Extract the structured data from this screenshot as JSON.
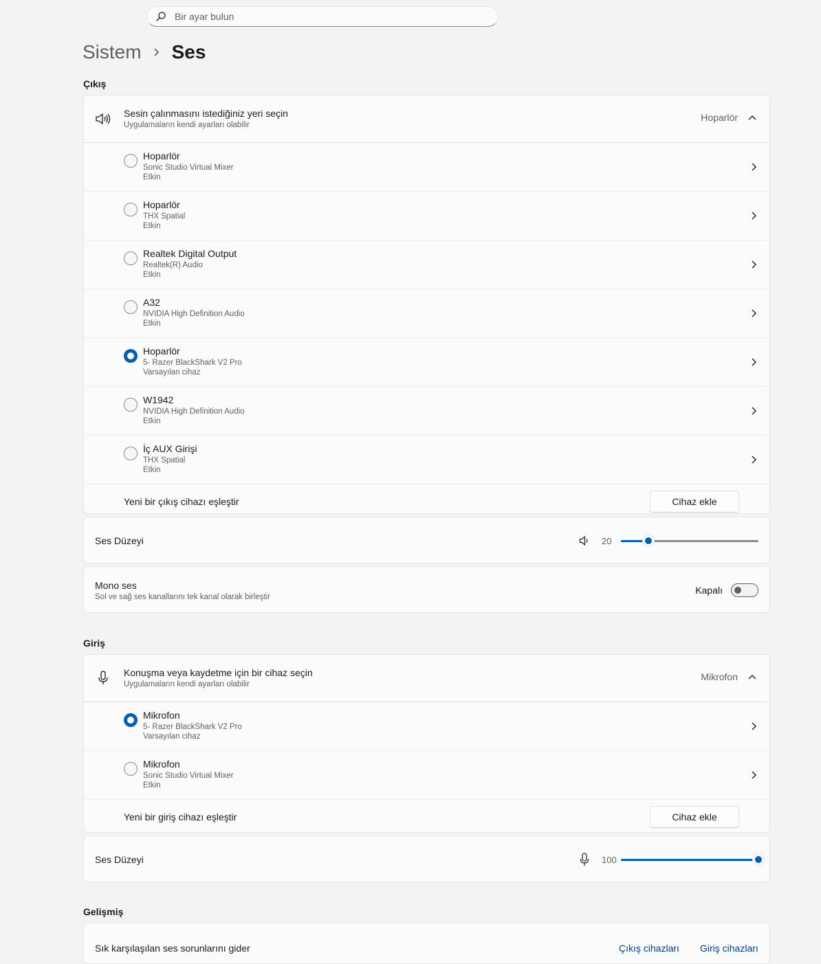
{
  "search": {
    "placeholder": "Bir ayar bulun"
  },
  "breadcrumb": {
    "parent": "Sistem",
    "current": "Ses"
  },
  "output": {
    "section_title": "Çıkış",
    "header": {
      "title": "Sesin çalınmasını istediğiniz yeri seçin",
      "subtitle": "Uygulamaların kendi ayarları olabilir",
      "value": "Hoparlör"
    },
    "devices": [
      {
        "name": "Hoparlör",
        "desc": "Sonic Studio Virtual Mixer",
        "status": "Etkin",
        "selected": false
      },
      {
        "name": "Hoparlör",
        "desc": "THX Spatial",
        "status": "Etkin",
        "selected": false
      },
      {
        "name": "Realtek Digital Output",
        "desc": "Realtek(R) Audio",
        "status": "Etkin",
        "selected": false
      },
      {
        "name": "A32",
        "desc": "NVIDIA High Definition Audio",
        "status": "Etkin",
        "selected": false
      },
      {
        "name": "Hoparlör",
        "desc": "5- Razer BlackShark V2 Pro",
        "status": "Varsayılan cihaz",
        "selected": true
      },
      {
        "name": "W1942",
        "desc": "NVIDIA High Definition Audio",
        "status": "Etkin",
        "selected": false
      },
      {
        "name": "İç AUX Girişi",
        "desc": "THX Spatial",
        "status": "Etkin",
        "selected": false
      }
    ],
    "pair_label": "Yeni bir çıkış cihazı eşleştir",
    "add_button": "Cihaz ekle",
    "volume": {
      "label": "Ses Düzeyi",
      "value": "20",
      "percent": 20
    },
    "mono": {
      "title": "Mono ses",
      "subtitle": "Sol ve sağ ses kanallarını tek kanal olarak birleştir",
      "state_label": "Kapalı",
      "on": false
    }
  },
  "input": {
    "section_title": "Giriş",
    "header": {
      "title": "Konuşma veya kaydetme için bir cihaz seçin",
      "subtitle": "Uygulamaların kendi ayarları olabilir",
      "value": "Mikrofon"
    },
    "devices": [
      {
        "name": "Mikrofon",
        "desc": "5- Razer BlackShark V2 Pro",
        "status": "Varsayılan cihaz",
        "selected": true
      },
      {
        "name": "Mikrofon",
        "desc": "Sonic Studio Virtual Mixer",
        "status": "Etkin",
        "selected": false
      }
    ],
    "pair_label": "Yeni bir giriş cihazı eşleştir",
    "add_button": "Cihaz ekle",
    "volume": {
      "label": "Ses Düzeyi",
      "value": "100",
      "percent": 100
    }
  },
  "advanced": {
    "section_title": "Gelişmiş",
    "troubleshoot": {
      "label": "Sık karşılaşılan ses sorunlarını gider",
      "link_output": "Çıkış cihazları",
      "link_input": "Giriş cihazları"
    }
  },
  "colors": {
    "accent": "#005fb8",
    "background": "#f3f3f3",
    "card": "#fbfbfb",
    "link": "#003e92"
  }
}
